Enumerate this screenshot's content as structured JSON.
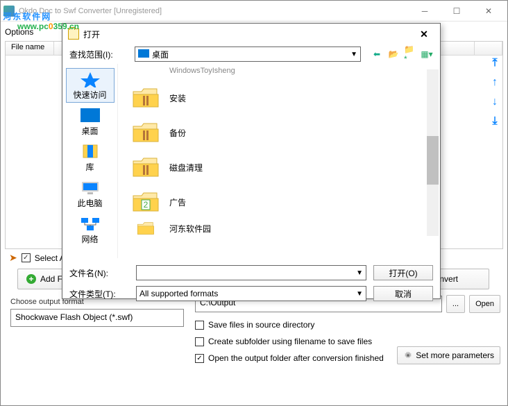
{
  "window": {
    "title": "Okdo Doc to Swf Converter [Unregistered]"
  },
  "watermark": {
    "text": "河东软件网",
    "url": "www.pc0359.cn"
  },
  "main": {
    "options_label": "Options",
    "file_col": "File name",
    "select_all": "Select All",
    "add_btn": "Add Files",
    "convert_btn": "Convert",
    "choose_label": "Choose output format",
    "format_value": "Shockwave Flash Object (*.swf)",
    "output_path": "C:\\Output",
    "browse_btn": "...",
    "open_btn": "Open",
    "opt1": "Save files in source directory",
    "opt2": "Create subfolder using filename to save files",
    "opt3": "Open the output folder after conversion finished",
    "opt3_checked": true,
    "more_params": "Set more parameters"
  },
  "dialog": {
    "title": "打开",
    "lookin_label": "查找范围(I):",
    "lookin_value": "桌面",
    "places": [
      {
        "label": "快速访问"
      },
      {
        "label": "桌面"
      },
      {
        "label": "库"
      },
      {
        "label": "此电脑"
      },
      {
        "label": "网络"
      }
    ],
    "files": [
      {
        "name": "安装"
      },
      {
        "name": "备份"
      },
      {
        "name": "磁盘清理"
      },
      {
        "name": "广告"
      },
      {
        "name": "河东软件园"
      }
    ],
    "filename_label": "文件名(N):",
    "filename_value": "",
    "filetype_label": "文件类型(T):",
    "filetype_value": "All supported formats",
    "open_btn": "打开(O)",
    "cancel_btn": "取消"
  }
}
